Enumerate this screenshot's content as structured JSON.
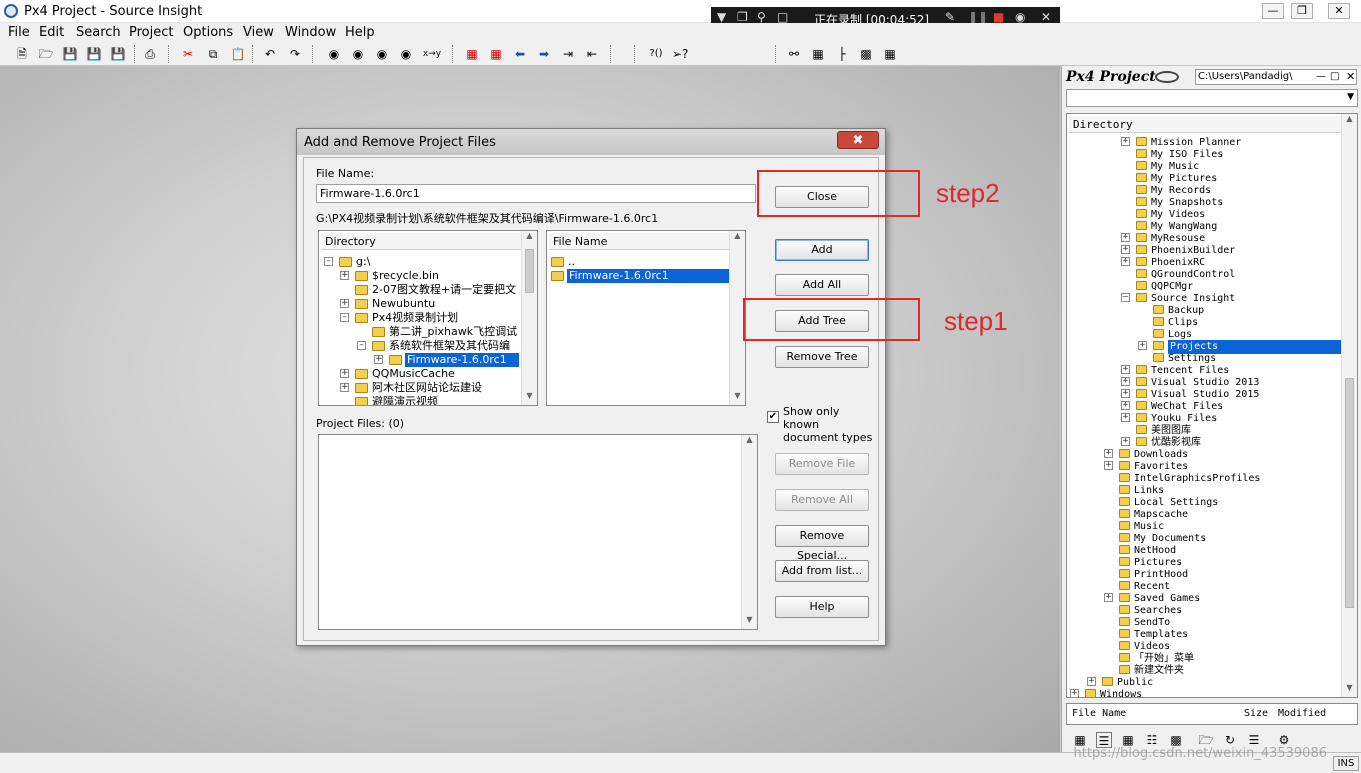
{
  "window": {
    "title": "Px4 Project - Source Insight"
  },
  "recording": {
    "status_text": "正在录制 [00:04:52]"
  },
  "menu": [
    "File",
    "Edit",
    "Search",
    "Project",
    "Options",
    "View",
    "Window",
    "Help"
  ],
  "dialog": {
    "title": "Add and Remove Project Files",
    "file_name_label": "File Name:",
    "file_name_value": "Firmware-1.6.0rc1",
    "current_path": "G:\\PX4视频录制计划\\系统软件框架及其代码编译\\Firmware-1.6.0rc1",
    "dir_header": "Directory",
    "file_header": "File Name",
    "dir_tree": [
      {
        "text": "g:\\"
      },
      {
        "text": "$recycle.bin"
      },
      {
        "text": "2-07图文教程+请一定要把文"
      },
      {
        "text": "Newubuntu"
      },
      {
        "text": "Px4视频录制计划"
      },
      {
        "text": "第二讲_pixhawk飞控调试"
      },
      {
        "text": "系统软件框架及其代码编"
      },
      {
        "text": "Firmware-1.6.0rc1"
      },
      {
        "text": "QQMusicCache"
      },
      {
        "text": "阿木社区网站论坛建设"
      },
      {
        "text": "避障演示视频"
      }
    ],
    "file_list": [
      {
        "text": ".."
      },
      {
        "text": "Firmware-1.6.0rc1"
      }
    ],
    "buttons": {
      "close": "Close",
      "add": "Add",
      "add_all": "Add All",
      "add_tree": "Add Tree",
      "remove_tree": "Remove Tree",
      "remove_file": "Remove File",
      "remove_all": "Remove All",
      "remove_special": "Remove Special...",
      "add_from_list": "Add from list...",
      "help": "Help"
    },
    "show_known_label": "Show only known document types",
    "project_files_label": "Project Files: (0)"
  },
  "annotations": {
    "step1": "step1",
    "step2": "step2"
  },
  "right_panel": {
    "title": "Px4 Project",
    "path": "C:\\Users\\Pandadig\\",
    "dir_header": "Directory",
    "tree": [
      "Mission Planner",
      "My ISO Files",
      "My Music",
      "My Pictures",
      "My Records",
      "My Snapshots",
      "My Videos",
      "My WangWang",
      "MyResouse",
      "PhoenixBuilder",
      "PhoenixRC",
      "QGroundControl",
      "QQPCMgr",
      "Source Insight",
      "Backup",
      "Clips",
      "Logs",
      "Projects",
      "Settings",
      "Tencent Files",
      "Visual Studio 2013",
      "Visual Studio 2015",
      "WeChat Files",
      "Youku Files",
      "美图图库",
      "优酷影视库",
      "Downloads",
      "Favorites",
      "IntelGraphicsProfiles",
      "Links",
      "Local Settings",
      "Mapscache",
      "Music",
      "My Documents",
      "NetHood",
      "Pictures",
      "PrintHood",
      "Recent",
      "Saved Games",
      "Searches",
      "SendTo",
      "Templates",
      "Videos",
      "「开始」菜单",
      "新建文件夹",
      "Public",
      "Windows"
    ],
    "files_header": {
      "name": "File Name",
      "size": "Size",
      "modified": "Modified"
    }
  },
  "status": {
    "mode": "INS"
  },
  "watermark": "https://blog.csdn.net/weixin_43539086"
}
